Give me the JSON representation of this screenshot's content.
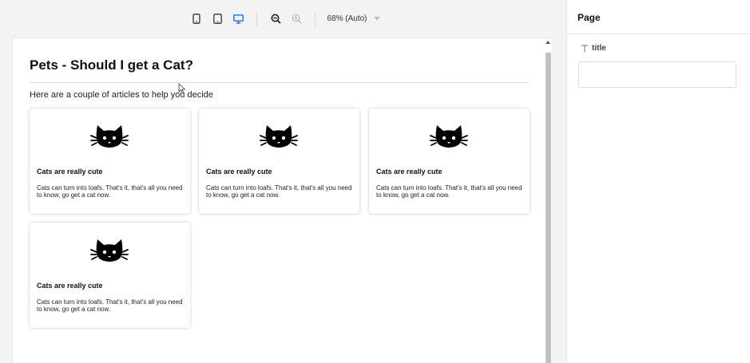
{
  "toolbar": {
    "devices": [
      {
        "name": "mobile-device-icon",
        "active": false
      },
      {
        "name": "tablet-device-icon",
        "active": false
      },
      {
        "name": "desktop-device-icon",
        "active": true
      }
    ],
    "zoom_label": "68% (Auto)",
    "active_color": "#1a73e8"
  },
  "page": {
    "title": "Pets - Should I get a Cat?",
    "intro": "Here are a couple of articles to help you decide",
    "cards": [
      {
        "icon": "cat-icon",
        "title": "Cats are really cute",
        "body": "Cats can turn into loafs. That's it, that's all you need to know, go get a cat now."
      },
      {
        "icon": "cat-icon",
        "title": "Cats are really cute",
        "body": "Cats can turn into loafs. That's it, that's all you need to know, go get a cat now."
      },
      {
        "icon": "cat-icon",
        "title": "Cats are really cute",
        "body": "Cats can turn into loafs. That's it, that's all you need to know, go get a cat now."
      },
      {
        "icon": "cat-icon",
        "title": "Cats are really cute",
        "body": "Cats can turn into loafs. That's it, that's all you need to know, go get a cat now."
      }
    ]
  },
  "panel": {
    "title": "Page",
    "fields": [
      {
        "icon": "text-type-icon",
        "label": "title",
        "value": "",
        "placeholder": ""
      }
    ]
  }
}
